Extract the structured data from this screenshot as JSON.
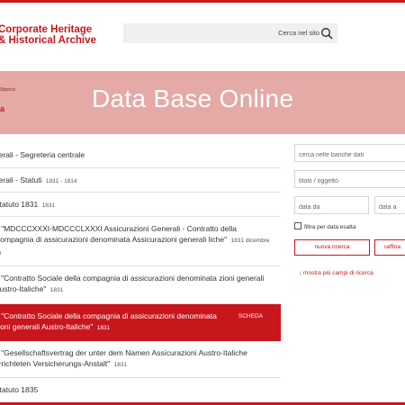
{
  "header": {
    "logo_line1": "Corporate Heritage",
    "logo_line2": "& Historical Archive",
    "search_placeholder": "Cerca nel sito"
  },
  "hero": {
    "breadcrumb": "Storico",
    "breadcrumb_sub": "a",
    "title": "Data Base Online"
  },
  "results": [
    {
      "text": "nerali - Segreteria centrale",
      "meta": "",
      "selected": false
    },
    {
      "text": "nerali - Statuti",
      "meta": "1831 - 1914",
      "selected": false
    },
    {
      "text": "Statuto 1831",
      "meta": "1831",
      "selected": false
    },
    {
      "text": "1 \"MDCCCXXXI-MDCCCLXXXI Assicurazioni Generali - Contratto della Compagnia di assicurazioni denominata Assicurazioni generali liche\"",
      "meta": "1831 dicembre 26",
      "selected": false
    },
    {
      "text": "2 \"Contratto Sociale della compagnia di assicurazioni denominata zioni generali Austro-Italiche\"",
      "meta": "1831",
      "selected": false
    },
    {
      "text": "3 \"Contratto Sociale della compagnia di assicurazioni denominata zioni generali Austro-Italiche\"",
      "meta": "1831",
      "selected": true,
      "action": "SCHEDA"
    },
    {
      "text": "4 \"Gesellschaftsvertrag der unter dem Namen Assicurazioni Austro-Italiche errichteten Versicherungs-Anstalt\"",
      "meta": "1831",
      "selected": false
    },
    {
      "text": "Statuto 1835",
      "meta": "",
      "selected": false
    }
  ],
  "sidebar": {
    "search_db_placeholder": "cerca nelle banche dati",
    "title_placeholder": "titolo / oggetto",
    "date_from_placeholder": "data da",
    "date_to_placeholder": "data a",
    "exact_date_label": "filtra per data esatta",
    "new_search_label": "nuova ricerca",
    "refine_label": "raffina",
    "more_fields_label": "↓  mostra più campi di ricerca"
  },
  "colors": {
    "accent": "#c8161d",
    "hero_bg": "#e5a9a6"
  }
}
